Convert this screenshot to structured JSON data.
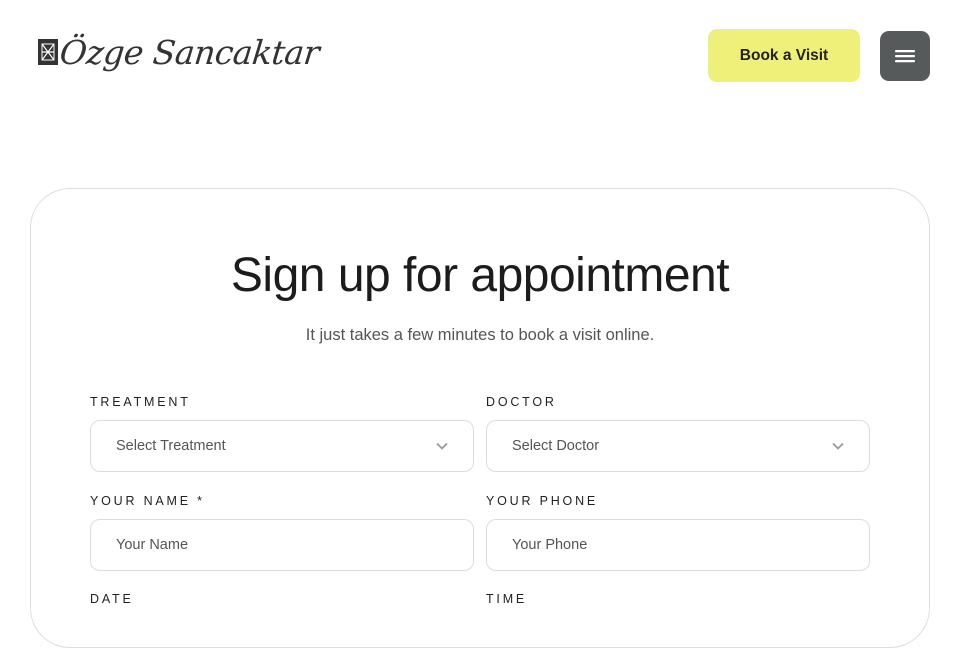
{
  "header": {
    "logo_text": "Özge Sancaktar",
    "book_button": "Book a Visit"
  },
  "main": {
    "title": "Sign up for appointment",
    "subtitle": "It just takes a few minutes to book a visit online."
  },
  "form": {
    "treatment": {
      "label": "TREATMENT",
      "value": "Select Treatment"
    },
    "doctor": {
      "label": "DOCTOR",
      "value": "Select Doctor"
    },
    "name": {
      "label": "YOUR NAME *",
      "placeholder": "Your Name"
    },
    "phone": {
      "label": "YOUR PHONE",
      "placeholder": "Your Phone"
    },
    "date": {
      "label": "DATE"
    },
    "time": {
      "label": "TIME"
    }
  },
  "icons": {
    "menu": "hamburger-menu-icon",
    "select": "chevron-down-icon",
    "logo": "logo-mark-icon"
  },
  "colors": {
    "accent": "#eef07a",
    "menu_button": "#565a5a",
    "border": "#dcdcdc"
  }
}
